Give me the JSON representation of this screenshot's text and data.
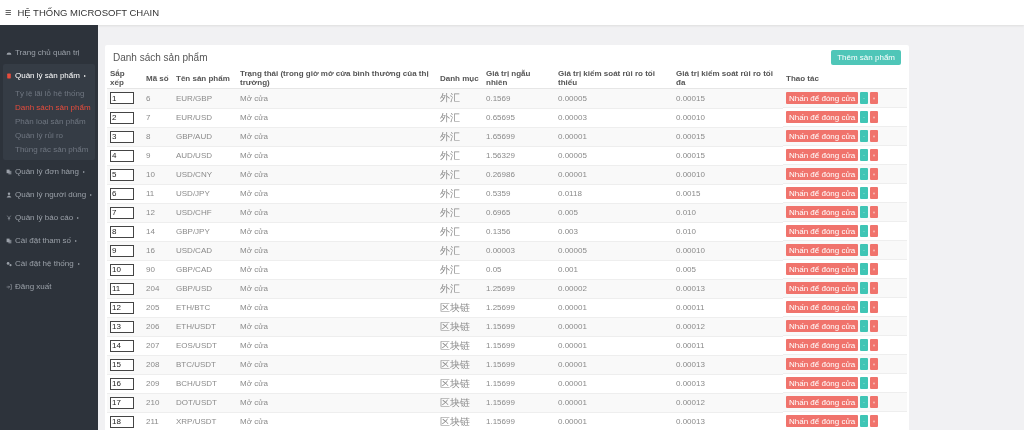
{
  "header": {
    "menu_icon": "≡",
    "title": "HỆ THỐNG MICROSOFT CHAIN"
  },
  "sidebar": {
    "items": [
      {
        "label": "Trang chủ quản trị",
        "expanded": false,
        "has_arrow": false,
        "selected": false
      },
      {
        "label": "Quản lý sản phẩm",
        "expanded": true,
        "has_arrow": true,
        "selected": true,
        "children": [
          {
            "label": "Tỷ lệ lãi lỗ hệ thống",
            "selected": false
          },
          {
            "label": "Danh sách sản phẩm",
            "selected": true
          },
          {
            "label": "Phân loại sản phẩm",
            "selected": false
          },
          {
            "label": "Quản lý rủi ro",
            "selected": false
          },
          {
            "label": "Thùng rác sản phẩm",
            "selected": false
          }
        ]
      },
      {
        "label": "Quản lý đơn hàng",
        "expanded": false,
        "has_arrow": true,
        "selected": false
      },
      {
        "label": "Quản lý người dùng",
        "expanded": false,
        "has_arrow": true,
        "selected": false
      },
      {
        "label": "Quản lý báo cáo",
        "expanded": false,
        "has_arrow": true,
        "selected": false
      },
      {
        "label": "Cài đặt tham số",
        "expanded": false,
        "has_arrow": true,
        "selected": false
      },
      {
        "label": "Cài đặt hệ thống",
        "expanded": false,
        "has_arrow": true,
        "selected": false
      },
      {
        "label": "Đăng xuất",
        "expanded": false,
        "has_arrow": false,
        "selected": false
      }
    ]
  },
  "panel": {
    "title": "Danh sách sản phẩm",
    "add_button": "Thêm sản phẩm"
  },
  "table": {
    "columns": [
      "Sắp xếp",
      "Mã số",
      "Tên sản phẩm",
      "Trạng thái (trong giờ mở cửa bình thường của thị trường)",
      "Danh mục",
      "Giá trị ngẫu nhiên",
      "Giá trị kiểm soát rủi ro tối thiểu",
      "Giá trị kiểm soát rủi ro tối đa",
      "Thao tác"
    ],
    "rows": [
      {
        "order": "1",
        "id": "6",
        "name": "EUR/GBP",
        "status": "Mở cửa",
        "category": "外汇",
        "random": "0.1569",
        "min": "0.00005",
        "max": "0.00015",
        "action": "Nhấn để đóng cửa"
      },
      {
        "order": "2",
        "id": "7",
        "name": "EUR/USD",
        "status": "Mở cửa",
        "category": "外汇",
        "random": "0.65695",
        "min": "0.00003",
        "max": "0.00010",
        "action": "Nhấn để đóng cửa"
      },
      {
        "order": "3",
        "id": "8",
        "name": "GBP/AUD",
        "status": "Mở cửa",
        "category": "外汇",
        "random": "1.65699",
        "min": "0.00001",
        "max": "0.00015",
        "action": "Nhấn để đóng cửa"
      },
      {
        "order": "4",
        "id": "9",
        "name": "AUD/USD",
        "status": "Mở cửa",
        "category": "外汇",
        "random": "1.56329",
        "min": "0.00005",
        "max": "0.00015",
        "action": "Nhấn để đóng cửa"
      },
      {
        "order": "5",
        "id": "10",
        "name": "USD/CNY",
        "status": "Mở cửa",
        "category": "外汇",
        "random": "0.26986",
        "min": "0.00001",
        "max": "0.00010",
        "action": "Nhấn để đóng cửa"
      },
      {
        "order": "6",
        "id": "11",
        "name": "USD/JPY",
        "status": "Mở cửa",
        "category": "外汇",
        "random": "0.5359",
        "min": "0.0118",
        "max": "0.0015",
        "action": "Nhấn để đóng cửa"
      },
      {
        "order": "7",
        "id": "12",
        "name": "USD/CHF",
        "status": "Mở cửa",
        "category": "外汇",
        "random": "0.6965",
        "min": "0.005",
        "max": "0.010",
        "action": "Nhấn để đóng cửa"
      },
      {
        "order": "8",
        "id": "14",
        "name": "GBP/JPY",
        "status": "Mở cửa",
        "category": "外汇",
        "random": "0.1356",
        "min": "0.003",
        "max": "0.010",
        "action": "Nhấn để đóng cửa"
      },
      {
        "order": "9",
        "id": "16",
        "name": "USD/CAD",
        "status": "Mở cửa",
        "category": "外汇",
        "random": "0.00003",
        "min": "0.00005",
        "max": "0.00010",
        "action": "Nhấn để đóng cửa"
      },
      {
        "order": "10",
        "id": "90",
        "name": "GBP/CAD",
        "status": "Mở cửa",
        "category": "外汇",
        "random": "0.05",
        "min": "0.001",
        "max": "0.005",
        "action": "Nhấn để đóng cửa"
      },
      {
        "order": "11",
        "id": "204",
        "name": "GBP/USD",
        "status": "Mở cửa",
        "category": "外汇",
        "random": "1.25699",
        "min": "0.00002",
        "max": "0.00013",
        "action": "Nhấn để đóng cửa"
      },
      {
        "order": "12",
        "id": "205",
        "name": "ETH/BTC",
        "status": "Mở cửa",
        "category": "区块链",
        "random": "1.25699",
        "min": "0.00001",
        "max": "0.00011",
        "action": "Nhấn để đóng cửa"
      },
      {
        "order": "13",
        "id": "206",
        "name": "ETH/USDT",
        "status": "Mở cửa",
        "category": "区块链",
        "random": "1.15699",
        "min": "0.00001",
        "max": "0.00012",
        "action": "Nhấn để đóng cửa"
      },
      {
        "order": "14",
        "id": "207",
        "name": "EOS/USDT",
        "status": "Mở cửa",
        "category": "区块链",
        "random": "1.15699",
        "min": "0.00001",
        "max": "0.00011",
        "action": "Nhấn để đóng cửa"
      },
      {
        "order": "15",
        "id": "208",
        "name": "BTC/USDT",
        "status": "Mở cửa",
        "category": "区块链",
        "random": "1.15699",
        "min": "0.00001",
        "max": "0.00013",
        "action": "Nhấn để đóng cửa"
      },
      {
        "order": "16",
        "id": "209",
        "name": "BCH/USDT",
        "status": "Mở cửa",
        "category": "区块链",
        "random": "1.15699",
        "min": "0.00001",
        "max": "0.00013",
        "action": "Nhấn để đóng cửa"
      },
      {
        "order": "17",
        "id": "210",
        "name": "DOT/USDT",
        "status": "Mở cửa",
        "category": "区块链",
        "random": "1.15699",
        "min": "0.00001",
        "max": "0.00012",
        "action": "Nhấn để đóng cửa"
      },
      {
        "order": "18",
        "id": "211",
        "name": "XRP/USDT",
        "status": "Mở cửa",
        "category": "区块链",
        "random": "1.15699",
        "min": "0.00001",
        "max": "0.00013",
        "action": "Nhấn để đóng cửa"
      }
    ]
  }
}
